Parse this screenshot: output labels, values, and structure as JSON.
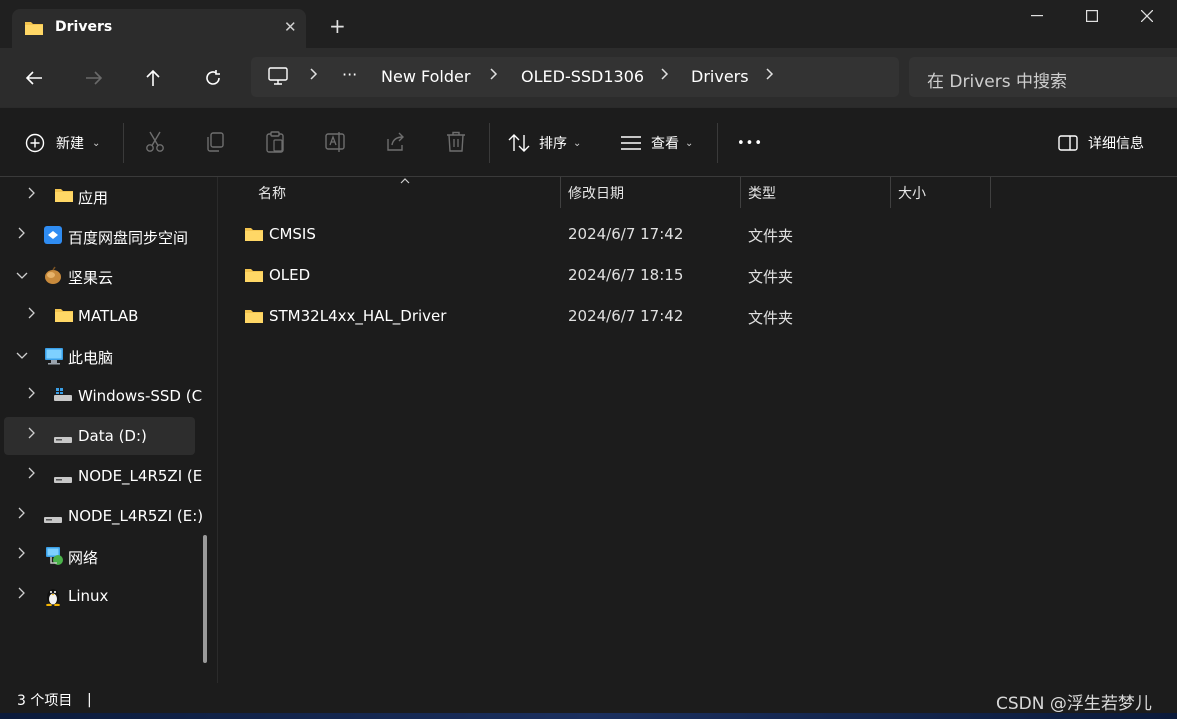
{
  "titlebar": {
    "tab_title": "Drivers",
    "tab_close": "✕",
    "new_tab": "+",
    "minimize": "—",
    "maximize": "☐",
    "close": "✕"
  },
  "nav": {
    "address": {
      "ellipsis": "···",
      "crumbs": [
        "New Folder",
        "OLED-SSD1306",
        "Drivers"
      ]
    },
    "search_placeholder": "在 Drivers 中搜索"
  },
  "toolbar": {
    "new_label": "新建",
    "sort_label": "排序",
    "view_label": "查看",
    "more_label": "•••",
    "details_label": "详细信息"
  },
  "sidebar": {
    "items": [
      {
        "label": "应用",
        "icon": "folder-icon"
      },
      {
        "label": "百度网盘同步空间",
        "icon": "baidu-cloud-icon"
      },
      {
        "label": "坚果云",
        "icon": "nutstore-icon"
      },
      {
        "label": "MATLAB",
        "icon": "folder-icon"
      },
      {
        "label": "此电脑",
        "icon": "computer-icon"
      },
      {
        "label": "Windows-SSD (C",
        "icon": "drive-icon"
      },
      {
        "label": "Data (D:)",
        "icon": "drive-icon"
      },
      {
        "label": "NODE_L4R5ZI (E",
        "icon": "drive-icon"
      },
      {
        "label": "NODE_L4R5ZI (E:)",
        "icon": "drive-icon"
      },
      {
        "label": "网络",
        "icon": "network-icon"
      },
      {
        "label": "Linux",
        "icon": "linux-penguin-icon"
      }
    ]
  },
  "list": {
    "columns": [
      "名称",
      "修改日期",
      "类型",
      "大小"
    ],
    "rows": [
      {
        "name": "CMSIS",
        "date": "2024/6/7 17:42",
        "type": "文件夹",
        "size": ""
      },
      {
        "name": "OLED",
        "date": "2024/6/7 18:15",
        "type": "文件夹",
        "size": ""
      },
      {
        "name": "STM32L4xx_HAL_Driver",
        "date": "2024/6/7 17:42",
        "type": "文件夹",
        "size": ""
      }
    ]
  },
  "status": {
    "count_text": "3 个项目",
    "separator": "|",
    "watermark": "CSDN @浮生若梦儿"
  },
  "colors": {
    "background": "#1c1c1c",
    "folder_yellow": "#f3c44f",
    "accent_blue": "#4cc2ff"
  }
}
